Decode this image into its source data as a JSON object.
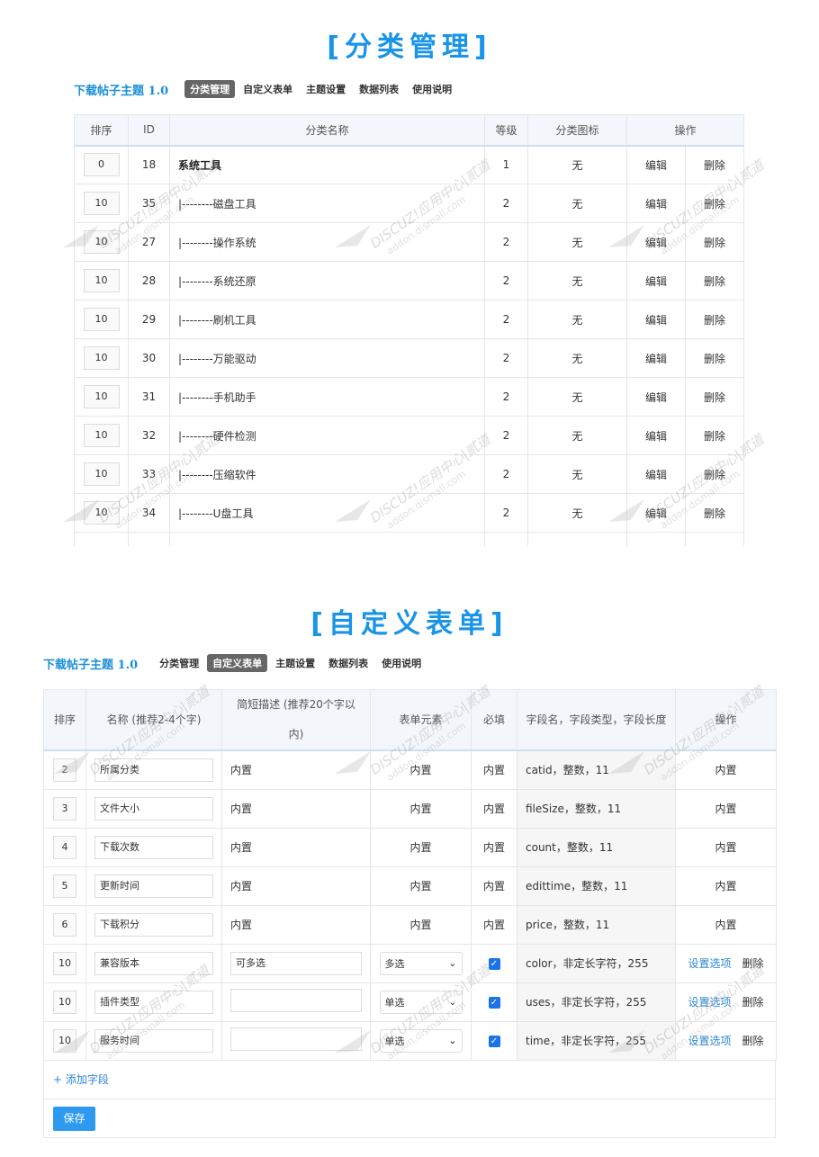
{
  "section1": {
    "title": "[分类管理]",
    "app_title": "下载帖子主题 1.0",
    "nav": [
      "分类管理",
      "自定义表单",
      "主题设置",
      "数据列表",
      "使用说明"
    ],
    "columns": [
      "排序",
      "ID",
      "分类名称",
      "等级",
      "分类图标",
      "操作"
    ],
    "edit_label": "编辑",
    "delete_label": "删除",
    "rows": [
      {
        "order": "0",
        "id": "18",
        "name": "系统工具",
        "level": "1",
        "icon": "无"
      },
      {
        "order": "10",
        "id": "35",
        "name": "|--------磁盘工具",
        "level": "2",
        "icon": "无"
      },
      {
        "order": "10",
        "id": "27",
        "name": "|--------操作系统",
        "level": "2",
        "icon": "无"
      },
      {
        "order": "10",
        "id": "28",
        "name": "|--------系统还原",
        "level": "2",
        "icon": "无"
      },
      {
        "order": "10",
        "id": "29",
        "name": "|--------刷机工具",
        "level": "2",
        "icon": "无"
      },
      {
        "order": "10",
        "id": "30",
        "name": "|--------万能驱动",
        "level": "2",
        "icon": "无"
      },
      {
        "order": "10",
        "id": "31",
        "name": "|--------手机助手",
        "level": "2",
        "icon": "无"
      },
      {
        "order": "10",
        "id": "32",
        "name": "|--------硬件检测",
        "level": "2",
        "icon": "无"
      },
      {
        "order": "10",
        "id": "33",
        "name": "|--------压缩软件",
        "level": "2",
        "icon": "无"
      },
      {
        "order": "10",
        "id": "34",
        "name": "|--------U盘工具",
        "level": "2",
        "icon": "无"
      }
    ]
  },
  "section2": {
    "title": "[自定义表单]",
    "app_title": "下载帖子主题 1.0",
    "nav": [
      "分类管理",
      "自定义表单",
      "主题设置",
      "数据列表",
      "使用说明"
    ],
    "columns": [
      "排序",
      "名称 (推荐2-4个字)",
      "简短描述 (推荐20个字以内)",
      "表单元素",
      "必填",
      "字段名，字段类型，字段长度",
      "操作"
    ],
    "builtin_label": "内置",
    "setup_label": "设置选项",
    "delete_label": "删除",
    "add_field": "+ 添加字段",
    "save": "保存",
    "rows": [
      {
        "order": "2",
        "name": "所属分类",
        "desc": "内置",
        "element": "内置",
        "required": "内置",
        "field": "catid，整数，11",
        "builtin": true
      },
      {
        "order": "3",
        "name": "文件大小",
        "desc": "内置",
        "element": "内置",
        "required": "内置",
        "field": "fileSize，整数，11",
        "builtin": true
      },
      {
        "order": "4",
        "name": "下载次数",
        "desc": "内置",
        "element": "内置",
        "required": "内置",
        "field": "count，整数，11",
        "builtin": true
      },
      {
        "order": "5",
        "name": "更新时间",
        "desc": "内置",
        "element": "内置",
        "required": "内置",
        "field": "edittime，整数，11",
        "builtin": true
      },
      {
        "order": "6",
        "name": "下载积分",
        "desc": "内置",
        "element": "内置",
        "required": "内置",
        "field": "price，整数，11",
        "builtin": true
      },
      {
        "order": "10",
        "name": "兼容版本",
        "desc": "可多选",
        "element": "多选",
        "required": "checked",
        "field": "color，非定长字符，255",
        "builtin": false
      },
      {
        "order": "10",
        "name": "插件类型",
        "desc": "",
        "element": "单选",
        "required": "checked",
        "field": "uses，非定长字符，255",
        "builtin": false
      },
      {
        "order": "10",
        "name": "服务时间",
        "desc": "",
        "element": "单选",
        "required": "checked",
        "field": "time，非定长字符，255",
        "builtin": false
      }
    ]
  },
  "watermark": {
    "line1": "DISCUZ!应用中心",
    "line2": "addon.dismall.com",
    "brand": "贰道"
  },
  "colors": {
    "accent": "#1a94e6",
    "link": "#2a86d0",
    "button": "#2d9af0",
    "header_bg": "#f3f7fb"
  }
}
